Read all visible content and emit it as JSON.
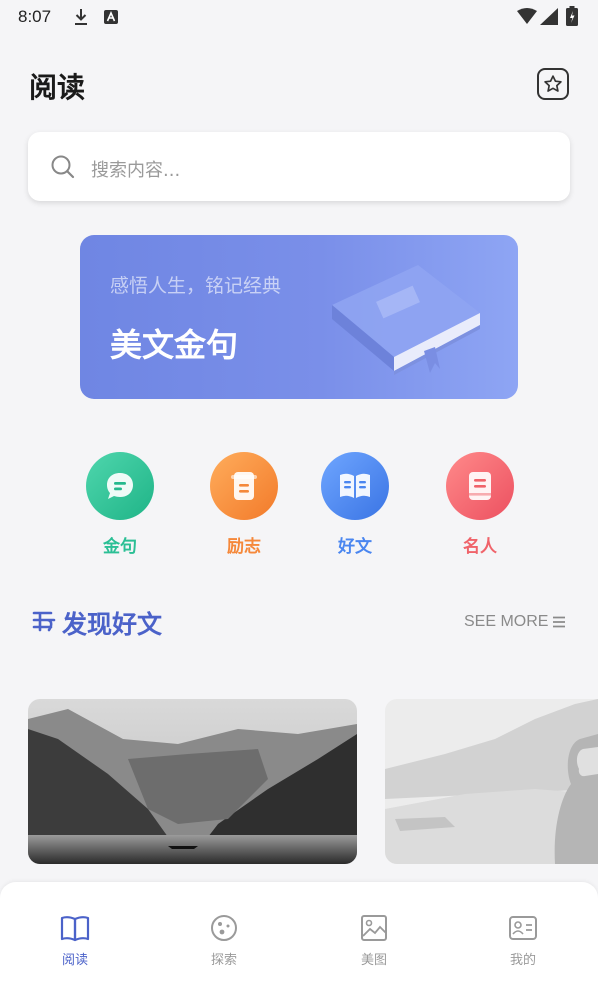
{
  "status": {
    "time": "8:07"
  },
  "header": {
    "title": "阅读"
  },
  "search": {
    "placeholder": "搜索内容..."
  },
  "banner": {
    "subtitle": "感悟人生，铭记经典",
    "title": "美文金句"
  },
  "categories": [
    {
      "label": "金句",
      "color": "#2bbf95",
      "icon": "chat-bubble-icon"
    },
    {
      "label": "励志",
      "color": "#f5883a",
      "icon": "note-icon"
    },
    {
      "label": "好文",
      "color": "#4a86f0",
      "icon": "open-book-icon"
    },
    {
      "label": "名人",
      "color": "#f0636a",
      "icon": "book-icon"
    }
  ],
  "section": {
    "title": "发现好文",
    "see_more": "SEE MORE"
  },
  "nav": [
    {
      "label": "阅读",
      "icon": "book-icon",
      "active": true
    },
    {
      "label": "探索",
      "icon": "planet-icon",
      "active": false
    },
    {
      "label": "美图",
      "icon": "image-icon",
      "active": false
    },
    {
      "label": "我的",
      "icon": "id-card-icon",
      "active": false
    }
  ],
  "colors": {
    "accent": "#4b62c9",
    "inactive": "#9a9a9a"
  }
}
